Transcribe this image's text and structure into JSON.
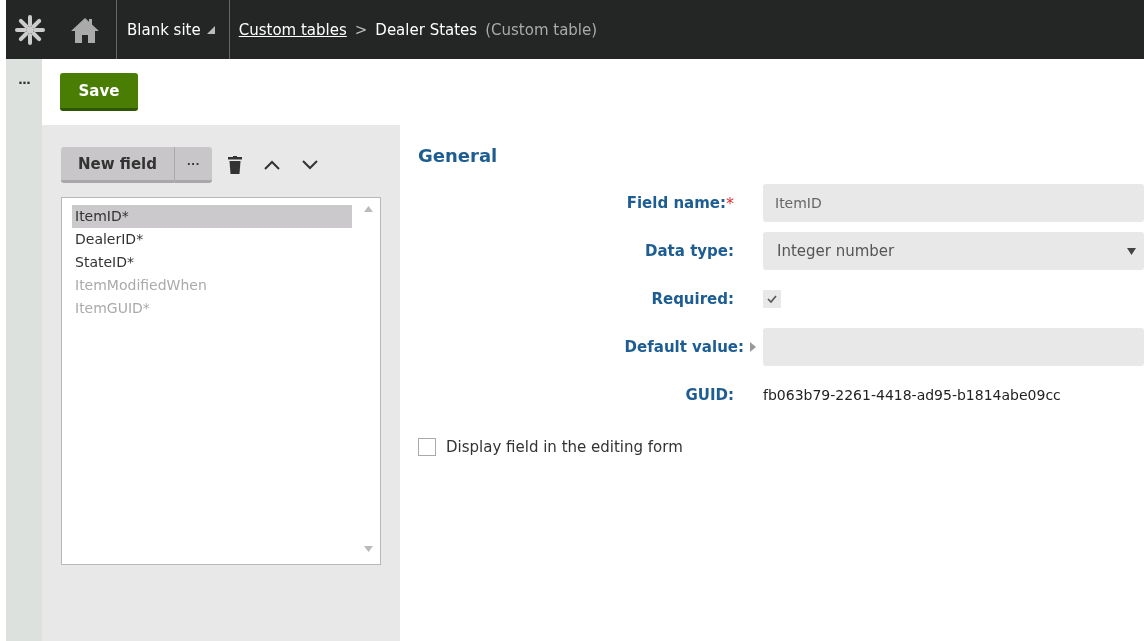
{
  "topbar": {
    "site": "Blank site",
    "breadcrumb_link": "Custom tables",
    "separator": ">",
    "page": "Dealer States",
    "page_type": "(Custom table)"
  },
  "side_strip": {
    "menu": "···"
  },
  "toolbar": {
    "save": "Save"
  },
  "field_toolbar": {
    "new_field": "New field",
    "more": "···"
  },
  "fields": [
    {
      "label": "ItemID*",
      "selected": true,
      "disabled": false
    },
    {
      "label": "DealerID*",
      "selected": false,
      "disabled": false
    },
    {
      "label": "StateID*",
      "selected": false,
      "disabled": false
    },
    {
      "label": "ItemModifiedWhen",
      "selected": false,
      "disabled": true
    },
    {
      "label": "ItemGUID*",
      "selected": false,
      "disabled": true
    }
  ],
  "section_title": "General",
  "form": [
    {
      "kind": "text",
      "label": "Field name:",
      "required_mark": "*",
      "value": "ItemID"
    },
    {
      "kind": "select",
      "label": "Data type:",
      "value": "Integer number"
    },
    {
      "kind": "checkbox",
      "label": "Required:",
      "checked": true
    },
    {
      "kind": "expander",
      "label": "Default value:"
    },
    {
      "kind": "static",
      "label": "GUID:",
      "value": "fb063b79-2261-4418-ad95-b1814abe09cc"
    }
  ],
  "display_option": {
    "label": "Display field in the editing form",
    "checked": false
  }
}
